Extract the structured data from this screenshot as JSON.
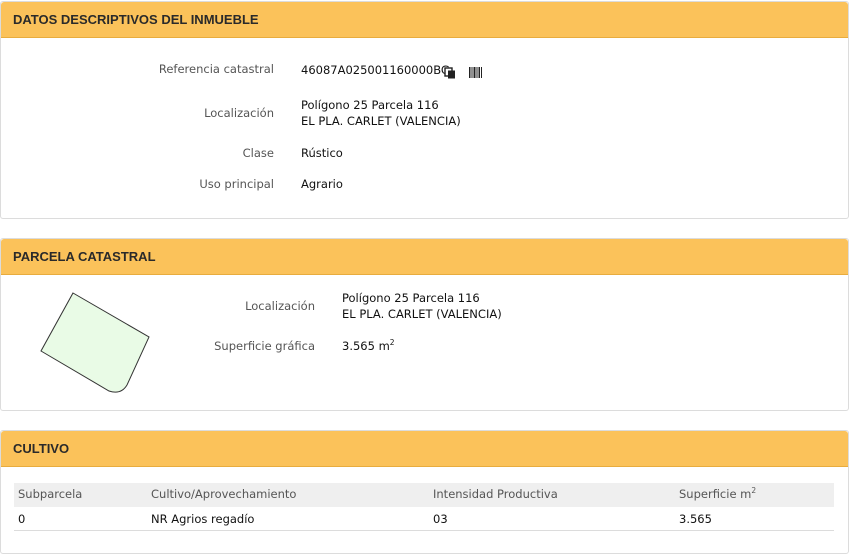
{
  "inmueble": {
    "title": "DATOS DESCRIPTIVOS DEL INMUEBLE",
    "ref_label": "Referencia catastral",
    "ref_value": "46087A025001160000BG",
    "loc_label": "Localización",
    "loc_line1": "Polígono 25 Parcela 116",
    "loc_line2": "EL PLA. CARLET (VALENCIA)",
    "clase_label": "Clase",
    "clase_value": "Rústico",
    "uso_label": "Uso principal",
    "uso_value": "Agrario"
  },
  "parcela": {
    "title": "PARCELA CATASTRAL",
    "loc_label": "Localización",
    "loc_line1": "Polígono 25 Parcela 116",
    "loc_line2": "EL PLA. CARLET (VALENCIA)",
    "sup_label": "Superficie gráfica",
    "sup_value": "3.565 m",
    "sup_exp": "2"
  },
  "cultivo": {
    "title": "CULTIVO",
    "headers": [
      "Subparcela",
      "Cultivo/Aprovechamiento",
      "Intensidad Productiva",
      "Superficie m"
    ],
    "header_exp": "2",
    "rows": [
      [
        "0",
        "NR Agrios regadío",
        "03",
        "3.565"
      ]
    ]
  },
  "icons": {
    "copy": "copy-icon",
    "barcode": "barcode-icon"
  },
  "colors": {
    "header_bg": "#fbc25a",
    "parcel_fill": "#e9fbe6"
  }
}
